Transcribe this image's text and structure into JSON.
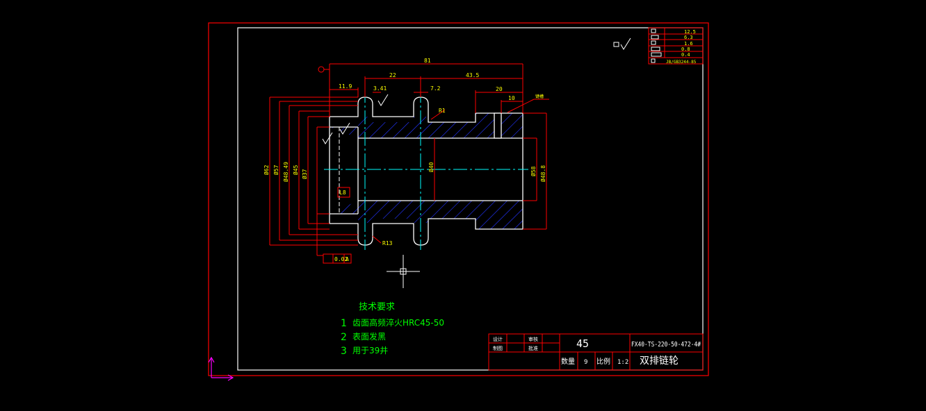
{
  "colors": {
    "background": "#000000",
    "border_outer": "#ff0000",
    "border_inner": "#ffffff",
    "outline": "#ffffff",
    "dimension": "#ff0000",
    "dim_text": "#ffff00",
    "centerline": "#00ffff",
    "hatch": "#0000ff",
    "notes": "#00ff00",
    "ucs": "#ff00ff"
  },
  "dimensions": {
    "d81": "81",
    "d22": "22",
    "d435": "43.5",
    "d119": "11.9",
    "d341": "3.41",
    "d72": "7.2",
    "d20": "20",
    "d10": "10",
    "r1": "R1",
    "r13": "R13",
    "dia62": "Ø62",
    "dia57": "Ø57",
    "dia4849": "Ø48.49",
    "dia45": "Ø45",
    "dia37": "Ø37",
    "dia40": "Ø40",
    "dia58": "Ø58",
    "dia488": "Ø48.8",
    "l8": "L8",
    "perp_tol": "0.02",
    "datum": "A",
    "leader_note": "键槽",
    "roughness": "√"
  },
  "tech_req": {
    "title": "技术要求",
    "item1_num": "1",
    "item1_text": "齿面高频淬火HRC45-50",
    "item2_num": "2",
    "item2_text": "表面发黑",
    "item3_num": "3",
    "item3_text": "用于39井"
  },
  "roughness_table": {
    "r1": "12.5",
    "r2": "6.3",
    "r3": "1.6",
    "r4": "0.8",
    "r5": "0.4",
    "r6": "JB/GB3244-85"
  },
  "title_block": {
    "design": "设计",
    "check": "审核",
    "draw": "制图",
    "approve": "批准",
    "material": "45",
    "drawing_no": "FX40-TS-220-50-472-4#",
    "qty_label": "数量",
    "qty_value": "9",
    "scale_label": "比例",
    "scale_value": "1:2",
    "part_name": "双排链轮"
  }
}
